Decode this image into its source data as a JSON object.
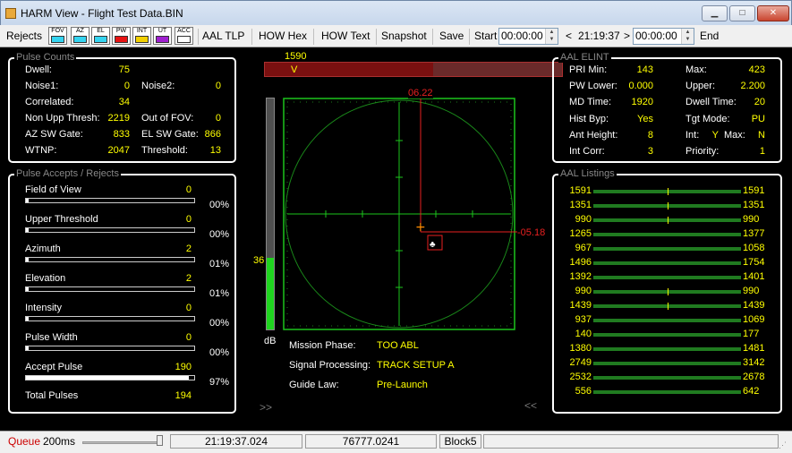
{
  "window": {
    "title": "HARM View - Flight Test Data.BIN"
  },
  "toolbar": {
    "rejects": "Rejects",
    "filters": [
      {
        "label": "FOV",
        "color": "#35d4f0"
      },
      {
        "label": "AZ",
        "color": "#35d4f0"
      },
      {
        "label": "EL",
        "color": "#35d4f0"
      },
      {
        "label": "PW",
        "color": "#e81414"
      },
      {
        "label": "INT",
        "color": "#f2d000"
      },
      {
        "label": "UT",
        "color": "#a020d0"
      },
      {
        "label": "ACC",
        "color": "#ffffff"
      }
    ],
    "aal_tlp": "AAL TLP",
    "how_hex": "HOW Hex",
    "how_text": "HOW Text",
    "snapshot": "Snapshot",
    "save": "Save",
    "start": "Start",
    "start_time": "00:00:00",
    "prev": "<",
    "current_time": "21:19:37",
    "next": ">",
    "end_time": "00:00:00",
    "end": "End"
  },
  "pulse_counts": {
    "title": "Pulse Counts",
    "rows": [
      {
        "l1": "Dwell:",
        "v1": "75",
        "l2": "",
        "v2": ""
      },
      {
        "l1": "Noise1:",
        "v1": "0",
        "l2": "Noise2:",
        "v2": "0"
      },
      {
        "l1": "Correlated:",
        "v1": "34",
        "l2": "",
        "v2": ""
      },
      {
        "l1": "Non Upp Thresh:",
        "v1": "2219",
        "l2": "Out of FOV:",
        "v2": "0"
      },
      {
        "l1": "AZ SW Gate:",
        "v1": "833",
        "l2": "EL SW Gate:",
        "v2": "866"
      },
      {
        "l1": "WTNP:",
        "v1": "2047",
        "l2": "Threshold:",
        "v2": "13"
      }
    ]
  },
  "pulse_accepts": {
    "title": "Pulse Accepts / Rejects",
    "items": [
      {
        "label": "Field of View",
        "value": "0",
        "pct": "00%",
        "fill": 0
      },
      {
        "label": "Upper Threshold",
        "value": "0",
        "pct": "00%",
        "fill": 0
      },
      {
        "label": "Azimuth",
        "value": "2",
        "pct": "01%",
        "fill": 0.01
      },
      {
        "label": "Elevation",
        "value": "2",
        "pct": "01%",
        "fill": 0.01
      },
      {
        "label": "Intensity",
        "value": "0",
        "pct": "00%",
        "fill": 0
      },
      {
        "label": "Pulse Width",
        "value": "0",
        "pct": "00%",
        "fill": 0
      },
      {
        "label": "Accept Pulse",
        "value": "190",
        "pct": "97%",
        "fill": 0.97
      }
    ],
    "total_label": "Total Pulses",
    "total_value": "194"
  },
  "scope": {
    "top_value": "1590",
    "top_marker": "V",
    "el_label": "06.22",
    "az_label": "-05.18",
    "db_value": "36",
    "db_label": "dB",
    "db_fill": 0.31,
    "left_arrows": ">>",
    "right_arrows": "<<",
    "info": [
      {
        "label": "Mission Phase:",
        "value": "TOO ABL"
      },
      {
        "label": "Signal Processing:",
        "value": "TRACK SETUP A"
      },
      {
        "label": "Guide Law:",
        "value": "Pre-Launch"
      }
    ]
  },
  "aal_elint": {
    "title": "AAL ELINT",
    "rows": [
      {
        "l1": "PRI Min:",
        "v1": "143",
        "l2": "Max:",
        "v2": "423"
      },
      {
        "l1": "PW Lower:",
        "v1": "0.000",
        "l2": "Upper:",
        "v2": "2.200"
      },
      {
        "l1": "MD Time:",
        "v1": "1920",
        "l2": "Dwell Time:",
        "v2": "20"
      },
      {
        "l1": "Hist Byp:",
        "v1": "Yes",
        "l2": "Tgt Mode:",
        "v2": "PU"
      },
      {
        "l1": "Ant Height:",
        "v1": "8",
        "l2": "Int:",
        "v2": "Y"
      },
      {
        "l1": "Int Corr:",
        "v1": "3",
        "l2": "Priority:",
        "v2": "1"
      }
    ],
    "max2_label": "Max:",
    "max2_value": "N"
  },
  "aal_listings": {
    "title": "AAL Listings",
    "rows": [
      {
        "a": "1591",
        "b": "1591",
        "tick": true
      },
      {
        "a": "1351",
        "b": "1351",
        "tick": true
      },
      {
        "a": "990",
        "b": "990",
        "tick": true
      },
      {
        "a": "1265",
        "b": "1377",
        "tick": false
      },
      {
        "a": "967",
        "b": "1058",
        "tick": false
      },
      {
        "a": "1496",
        "b": "1754",
        "tick": false
      },
      {
        "a": "1392",
        "b": "1401",
        "tick": false
      },
      {
        "a": "990",
        "b": "990",
        "tick": true
      },
      {
        "a": "1439",
        "b": "1439",
        "tick": true
      },
      {
        "a": "937",
        "b": "1069",
        "tick": false
      },
      {
        "a": "140",
        "b": "177",
        "tick": false
      },
      {
        "a": "1380",
        "b": "1481",
        "tick": false
      },
      {
        "a": "2749",
        "b": "3142",
        "tick": false
      },
      {
        "a": "2532",
        "b": "2678",
        "tick": false
      },
      {
        "a": "556",
        "b": "642",
        "tick": false
      }
    ]
  },
  "status": {
    "queue": "Queue",
    "interval": "200ms",
    "time": "21:19:37.024",
    "value": "76777.0241",
    "block": "Block5"
  }
}
